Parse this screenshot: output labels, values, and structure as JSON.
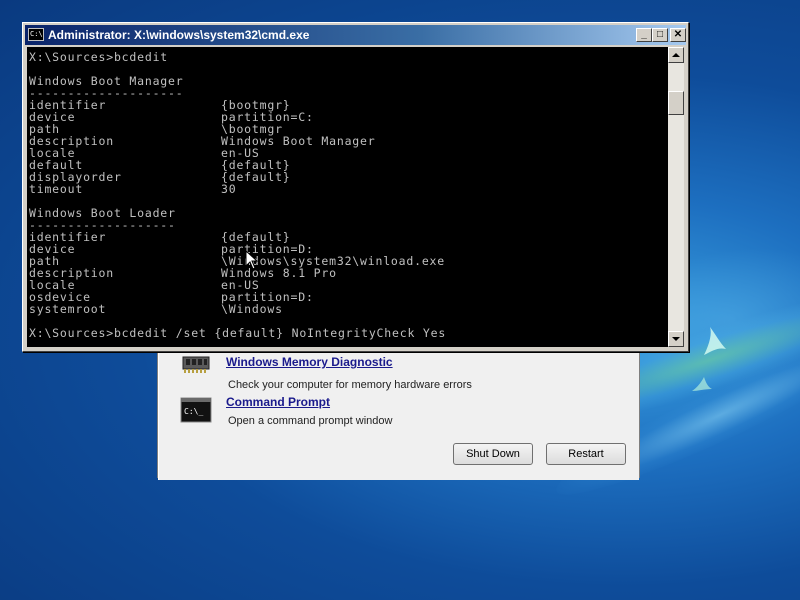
{
  "cmd_window": {
    "title": "Administrator: X:\\windows\\system32\\cmd.exe",
    "icon_text": "C:\\",
    "controls": {
      "minimize": "_",
      "maximize": "□",
      "close": "✕"
    },
    "lines": [
      {
        "text": "X:\\Sources>bcdedit"
      },
      {
        "text": ""
      },
      {
        "text": "Windows Boot Manager"
      },
      {
        "text": "--------------------"
      },
      {
        "key": "identifier",
        "value": "{bootmgr}"
      },
      {
        "key": "device",
        "value": "partition=C:"
      },
      {
        "key": "path",
        "value": "\\bootmgr"
      },
      {
        "key": "description",
        "value": "Windows Boot Manager"
      },
      {
        "key": "locale",
        "value": "en-US"
      },
      {
        "key": "default",
        "value": "{default}"
      },
      {
        "key": "displayorder",
        "value": "{default}"
      },
      {
        "key": "timeout",
        "value": "30"
      },
      {
        "text": ""
      },
      {
        "text": "Windows Boot Loader"
      },
      {
        "text": "-------------------"
      },
      {
        "key": "identifier",
        "value": "{default}"
      },
      {
        "key": "device",
        "value": "partition=D:"
      },
      {
        "key": "path",
        "value": "\\Windows\\system32\\winload.exe"
      },
      {
        "key": "description",
        "value": "Windows 8.1 Pro"
      },
      {
        "key": "locale",
        "value": "en-US"
      },
      {
        "key": "osdevice",
        "value": "partition=D:"
      },
      {
        "key": "systemroot",
        "value": "\\Windows"
      },
      {
        "text": ""
      },
      {
        "text": "X:\\Sources>bcdedit /set {default} NoIntegrityCheck Yes"
      }
    ]
  },
  "recovery": {
    "tools": [
      {
        "name": "Windows Memory Diagnostic",
        "description": "Check your computer for memory hardware errors",
        "icon": "memory-chip-icon"
      },
      {
        "name": "Command Prompt",
        "description": "Open a command prompt window",
        "icon": "command-prompt-icon"
      }
    ],
    "buttons": {
      "shutdown": "Shut Down",
      "restart": "Restart"
    }
  },
  "colors": {
    "console_bg": "#000000",
    "console_text": "#c0c0c0",
    "desktop": "#1d6fc0",
    "titlebar": "#0a246a"
  }
}
